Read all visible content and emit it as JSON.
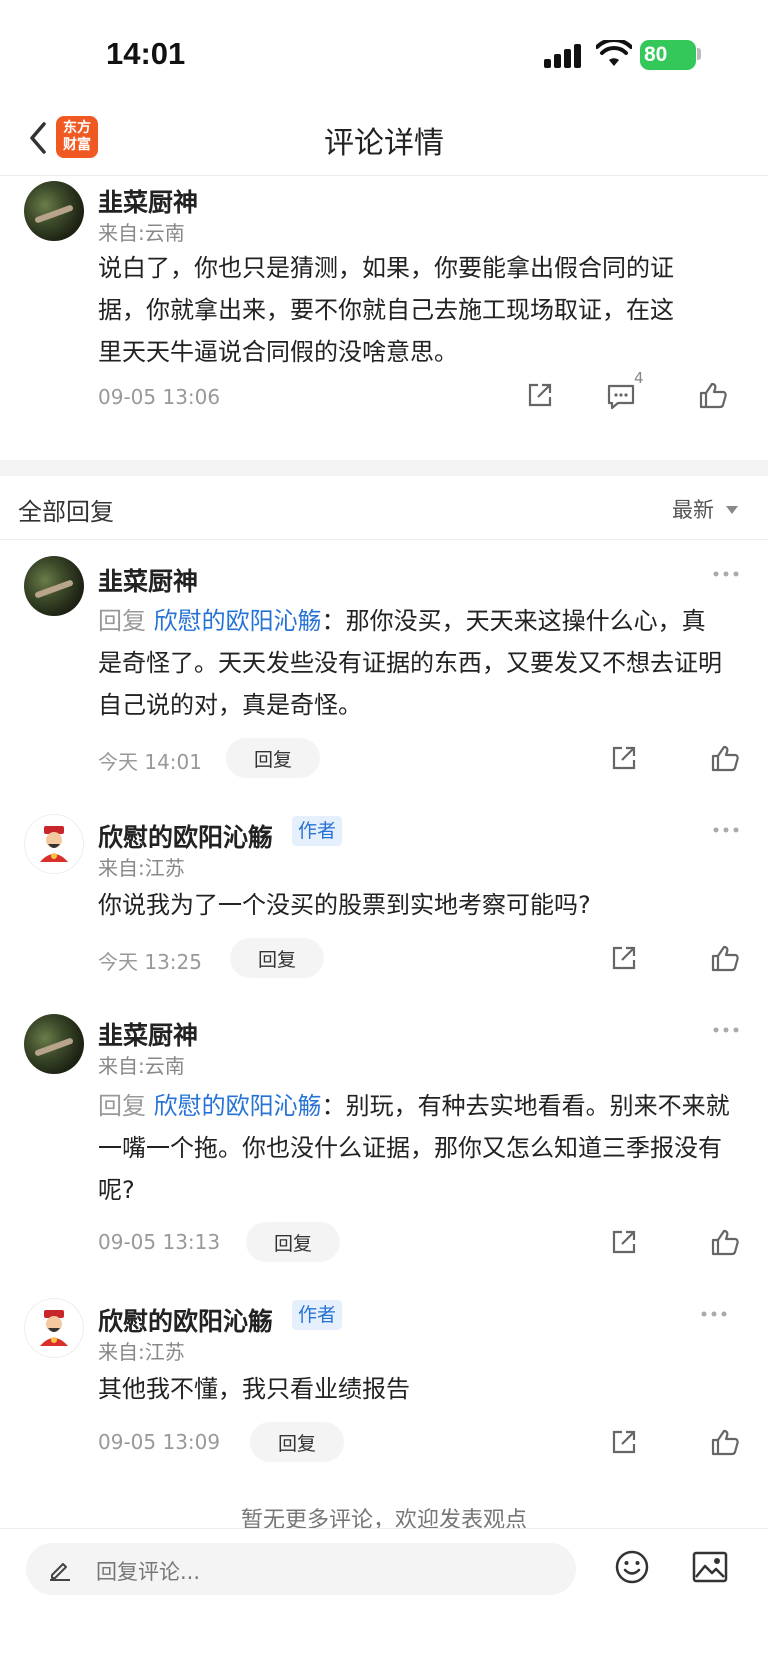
{
  "status_bar": {
    "time": "14:01",
    "battery": "80"
  },
  "nav": {
    "title": "评论详情",
    "logo_line1": "东方",
    "logo_line2": "财富"
  },
  "main_comment": {
    "user": "韭菜厨神",
    "location": "来自:云南",
    "text": "说白了，你也只是猜测，如果，你要能拿出假合同的证据，你就拿出来，要不你就自己去施工现场取证，在这里天天牛逼说合同假的没啥意思。",
    "time": "09-05 13:06",
    "reply_count": "4"
  },
  "replies_section": {
    "title": "全部回复",
    "sort": "最新"
  },
  "replies": [
    {
      "user": "韭菜厨神",
      "reply_prefix": "回复",
      "mention": "欣慰的欧阳沁觞",
      "text": "：那你没买，天天来这操什么心，真是奇怪了。天天发些没有证据的东西，又要发又不想去证明自己说的对，真是奇怪。",
      "time": "今天 14:01",
      "reply_label": "回复"
    },
    {
      "user": "欣慰的欧阳沁觞",
      "author_tag": "作者",
      "location": "来自:江苏",
      "text": "你说我为了一个没买的股票到实地考察可能吗?",
      "time": "今天 13:25",
      "reply_label": "回复"
    },
    {
      "user": "韭菜厨神",
      "location": "来自:云南",
      "reply_prefix": "回复",
      "mention": "欣慰的欧阳沁觞",
      "text": "：别玩，有种去实地看看。别来不来就一嘴一个拖。你也没什么证据，那你又怎么知道三季报没有呢?",
      "time": "09-05 13:13",
      "reply_label": "回复"
    },
    {
      "user": "欣慰的欧阳沁觞",
      "author_tag": "作者",
      "location": "来自:江苏",
      "text": "其他我不懂，我只看业绩报告",
      "time": "09-05 13:09",
      "reply_label": "回复"
    }
  ],
  "footer": {
    "no_more": "暂无更多评论，欢迎发表观点",
    "input_placeholder": "回复评论..."
  },
  "colors": {
    "accent_blue": "#2673d6",
    "brand_orange": "#f05a22",
    "battery_green": "#34c759"
  }
}
